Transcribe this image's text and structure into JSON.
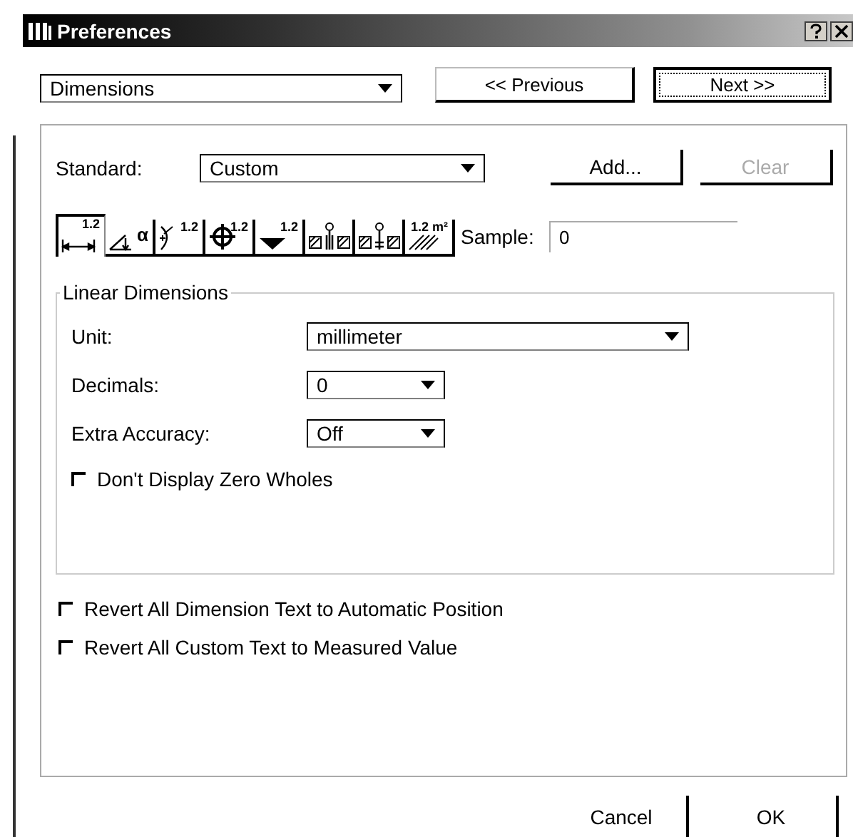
{
  "window": {
    "title": "Preferences"
  },
  "page_select": {
    "value": "Dimensions"
  },
  "nav_buttons": [
    {
      "label": "<< Previous",
      "default": false
    },
    {
      "label": "Next >>",
      "default": true
    }
  ],
  "standard": {
    "label": "Standard:",
    "value": "Custom",
    "buttons": [
      {
        "label": "Add...",
        "disabled": false
      },
      {
        "label": "Clear",
        "disabled": true
      }
    ]
  },
  "tabs": [
    {
      "kind": "linear",
      "label": "1.2",
      "selected": true
    },
    {
      "kind": "angular",
      "label": "α",
      "selected": false
    },
    {
      "kind": "radial",
      "label": "1.2",
      "selected": false
    },
    {
      "kind": "diameter",
      "label": "1.2",
      "selected": false
    },
    {
      "kind": "level",
      "label": "1.2",
      "selected": false
    },
    {
      "kind": "elevation",
      "selected": false
    },
    {
      "kind": "elevation-alt",
      "selected": false
    },
    {
      "kind": "area",
      "label": "1.2 m²",
      "selected": false
    }
  ],
  "sample": {
    "label": "Sample:",
    "value": "0"
  },
  "group": {
    "title": "Linear Dimensions",
    "fields": [
      {
        "label": "Unit:",
        "value": "millimeter",
        "kind": "wide"
      },
      {
        "label": "Decimals:",
        "value": "0",
        "kind": "narrow"
      },
      {
        "label": "Extra Accuracy:",
        "value": "Off",
        "kind": "narrow"
      }
    ],
    "checkbox": {
      "label": "Don't Display Zero Wholes",
      "checked": false
    }
  },
  "options": [
    {
      "label": "Revert All Dimension Text to Automatic Position",
      "checked": false
    },
    {
      "label": "Revert All Custom Text to Measured Value",
      "checked": false
    }
  ],
  "footer_buttons": [
    "Cancel",
    "OK"
  ]
}
